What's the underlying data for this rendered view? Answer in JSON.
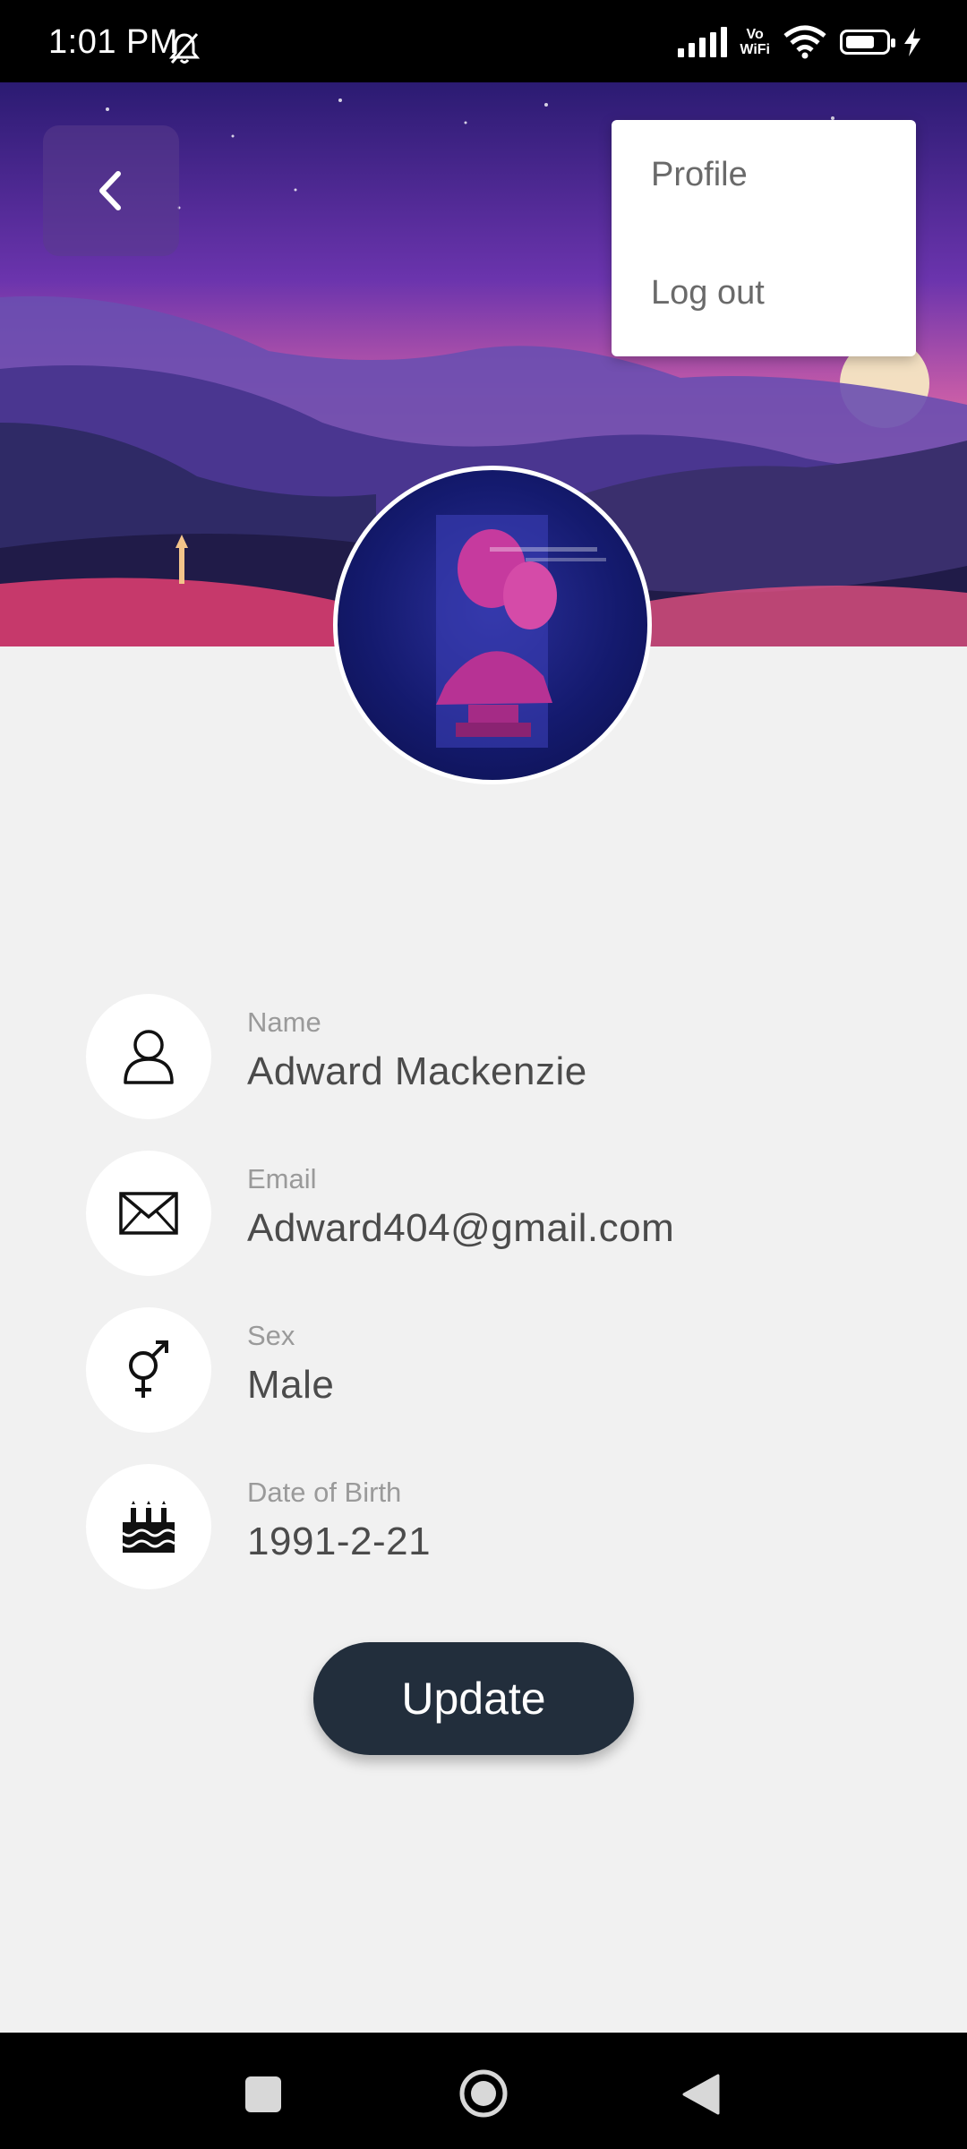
{
  "status_bar": {
    "time": "1:01 PM",
    "vowifi_line1": "Vo",
    "vowifi_line2": "WiFi",
    "icons": [
      "bell-muted-icon",
      "signal-icon",
      "vowifi-icon",
      "wifi-icon",
      "battery-icon",
      "charging-icon"
    ]
  },
  "menu": {
    "items": [
      {
        "label": "Profile"
      },
      {
        "label": "Log out"
      }
    ]
  },
  "profile": {
    "fields": [
      {
        "label": "Name",
        "value": "Adward Mackenzie",
        "icon": "person-icon"
      },
      {
        "label": "Email",
        "value": "Adward404@gmail.com",
        "icon": "envelope-icon"
      },
      {
        "label": "Sex",
        "value": "Male",
        "icon": "gender-icon"
      },
      {
        "label": "Date of Birth",
        "value": "1991-2-21",
        "icon": "birthday-cake-icon"
      }
    ],
    "update_label": "Update"
  },
  "colors": {
    "button_bg": "#222e3c",
    "page_bg": "#f1f1f1",
    "label_gray": "#9a9a9a",
    "value_gray": "#4b4b4b"
  }
}
